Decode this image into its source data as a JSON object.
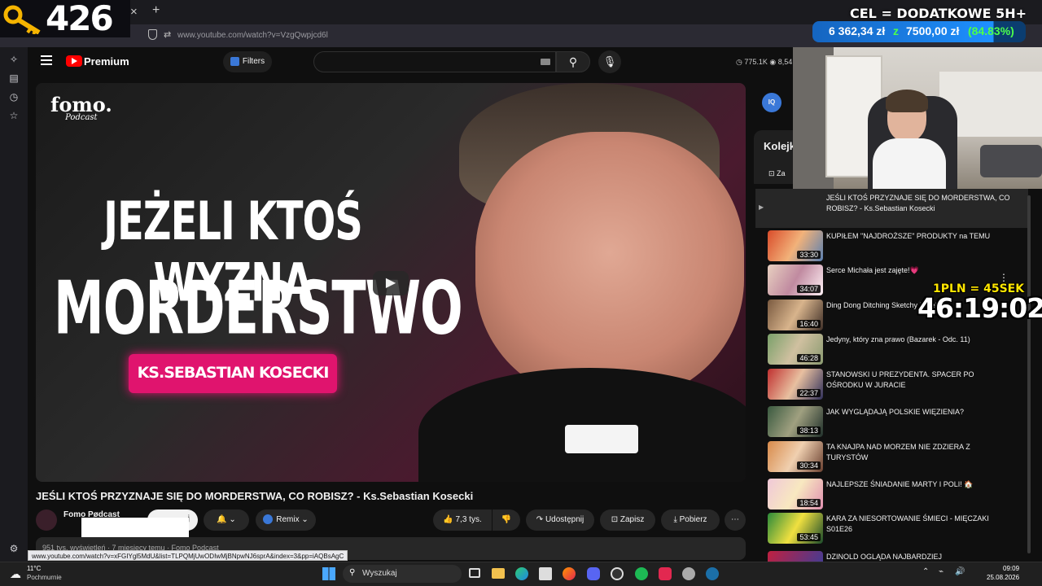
{
  "browser": {
    "tab_icon_close": "×",
    "new_tab": "+",
    "url": "www.youtube.com/watch?v=VzgQwpjcd6l",
    "status_url": "www.youtube.com/watch?v=xFGIYgl5MdU&list=TLPQMjUwODIwMjBNpwNJ6sprA&index=3&pp=iAQBsAgC"
  },
  "overlay": {
    "counter": "426",
    "goal_title": "CEL = DODATKOWE 5H+",
    "goal_current": "6 362,34 zł",
    "goal_of": "z",
    "goal_target": "7500,00 zł",
    "goal_percent": "(84.83%)",
    "rate": "1PLN = 45SEK",
    "timer": "46:19:02"
  },
  "youtube": {
    "logo_label": "Premium",
    "filters_label": "Filters",
    "stats_views": "775.1K",
    "stats_other": "8,54",
    "queue_label": "Kolejk",
    "queue_save": "Za",
    "thumbnail": {
      "logo_line1": "fomo.",
      "logo_line2": "Podcast",
      "line1": "JEŻELI KTOŚ WYZNA",
      "line2": "MORDERSTWO",
      "name_tag": "KS.SEBASTIAN KOSECKI"
    },
    "video_title": "JEŚLI KTOŚ PRZYZNAJE SIĘ DO MORDERSTWA, CO ROBISZ? - Ks.Sebastian Kosecki",
    "channel_name": "Fomo Pødcast",
    "subscribe_partial": "j",
    "remix_label": "Remix",
    "like_count": "7,3 tys.",
    "share_label": "Udostępnij",
    "save_label": "Zapisz",
    "download_label": "Pobierz",
    "description_partial": "951 tys. wyświetleń · 7 miesięcy temu · Fomo Podcast"
  },
  "queue": [
    {
      "title": "JEŚLI KTOŚ PRZYZNAJE SIĘ DO MORDERSTWA, CO ROBISZ? - Ks.Sebastian Kosecki",
      "duration": ""
    },
    {
      "title": "KUPIŁEM \"NAJDROŻSZE\" PRODUKTY na TEMU",
      "duration": "33:30"
    },
    {
      "title": "Serce Michała jest zajęte!💗",
      "duration": "34:07"
    },
    {
      "title": "Ding Dong Ditching Sketchy Hotel",
      "duration": "16:40"
    },
    {
      "title": "Jedyny, który zna prawo (Bazarek - Odc. 11)",
      "duration": "46:28"
    },
    {
      "title": "STANOWSKI U PREZYDENTA. SPACER PO OŚRODKU W JURACIE",
      "duration": "22:37"
    },
    {
      "title": "JAK WYGLĄDAJĄ POLSKIE WIĘZIENIA?",
      "duration": "38:13"
    },
    {
      "title": "TA KNAJPA NAD MORZEM NIE ZDZIERA Z TURYSTÓW",
      "duration": "30:34"
    },
    {
      "title": "NAJLEPSZE ŚNIADANIE MARTY I POLI! 🏠",
      "duration": "18:54"
    },
    {
      "title": "KARA ZA NIESORTOWANIE ŚMIECI - MIĘCZAKI S01E26",
      "duration": "53:45"
    },
    {
      "title": "DZINOLD OGLĄDA NAJBARDZIEJ",
      "duration": ""
    }
  ],
  "taskbar": {
    "weather_temp": "11°C",
    "weather_desc": "Pochmurnie",
    "search_placeholder": "Wyszukaj",
    "time": "09:09",
    "date": "25.08.2026"
  },
  "colors": {
    "yt_red": "#ff0000",
    "thumb_pink": "#e0146e",
    "goal_blue": "#1e90ff",
    "goal_green": "#4cff4c",
    "rate_yellow": "#ffe600"
  }
}
